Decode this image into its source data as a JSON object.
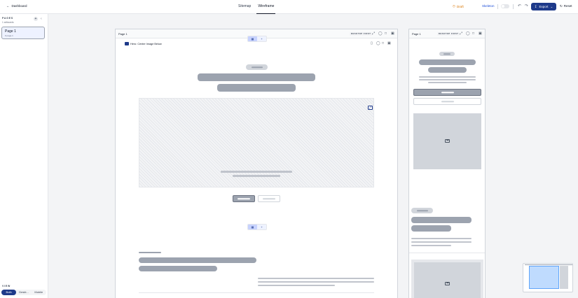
{
  "topbar": {
    "back_label": "Dashboard",
    "tabs": [
      {
        "label": "Sitemap",
        "active": false
      },
      {
        "label": "Wireframe",
        "active": true
      }
    ],
    "status": "Draft",
    "mode": "Skeleton",
    "export_label": "Export",
    "reset_label": "Reset"
  },
  "sidebar": {
    "pages_title": "PAGES",
    "artboards_count": "1 artboards",
    "pages": [
      {
        "name": "Page 1",
        "sub": "# page-1"
      }
    ],
    "view_title": "VIEW",
    "view_options": [
      {
        "label": "Both",
        "active": true
      },
      {
        "label": "Deskt...",
        "active": false
      },
      {
        "label": "Mobile",
        "active": false
      }
    ]
  },
  "artboards": {
    "desktop": {
      "name": "Page 1",
      "badge": "DESKTOP FIRST"
    },
    "mobile": {
      "name": "Page 1",
      "badge": "DESKTOP FIRST"
    }
  },
  "block": {
    "label": "Hero: Center Image Below"
  },
  "colors": {
    "accent": "#1e3a8a",
    "draft": "#d97706",
    "skeleton": "#1d4ed8",
    "placeholder": "#9ca3af"
  }
}
